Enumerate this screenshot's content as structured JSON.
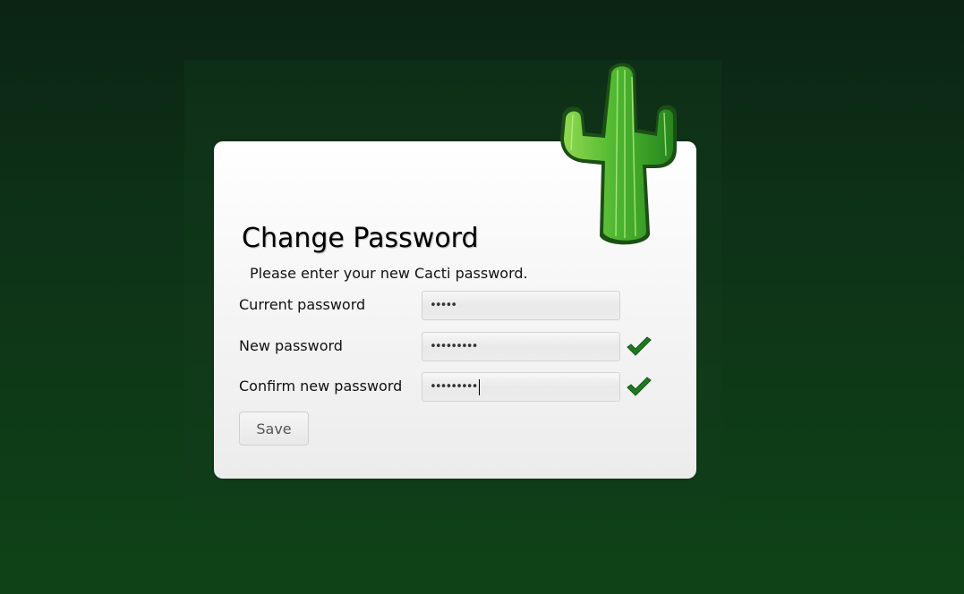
{
  "page": {
    "title": "Change Password",
    "subtitle": "Please enter your new Cacti password."
  },
  "form": {
    "current_password": {
      "label": "Current password",
      "masked_value": "•••••",
      "valid": null
    },
    "new_password": {
      "label": "New password",
      "masked_value": "•••••••••",
      "valid": true
    },
    "confirm_password": {
      "label": "Confirm new password",
      "masked_value": "•••••••••",
      "valid": true
    },
    "save_label": "Save"
  },
  "icons": {
    "logo": "cactus-logo-icon",
    "valid": "checkmark-icon"
  },
  "colors": {
    "background_top": "#0c2413",
    "background_bottom": "#0f4317",
    "check_green": "#1f7a1f",
    "cactus_green": "#4fb335"
  }
}
